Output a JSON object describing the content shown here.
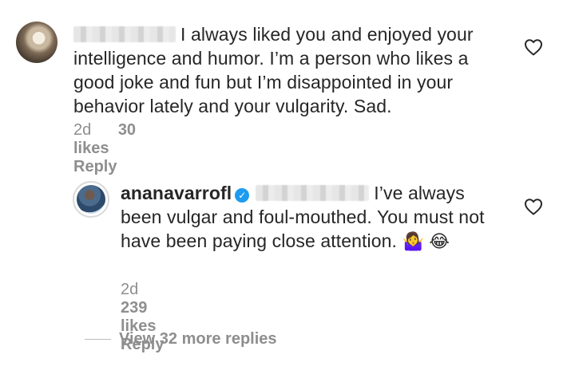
{
  "comment1": {
    "username_redacted": true,
    "text": "I always liked you and enjoyed your intelligence and humor. I’m a person who likes a good joke and fun but I’m disappointed in your behavior lately and your vulgarity. Sad.",
    "time": "2d",
    "likes": "30 likes",
    "reply_label": "Reply"
  },
  "comment2": {
    "username": "ananavarrofl",
    "verified": true,
    "mention_redacted": true,
    "text": "I’ve always been vulgar and foul-mouthed. You must not have been paying close attention.",
    "emojis": "🤷‍♀️ 😂",
    "time": "2d",
    "likes": "239 likes",
    "reply_label": "Reply"
  },
  "view_replies": "View 32 more replies",
  "icons": {
    "like": "heart-icon",
    "verified": "verified-badge-icon"
  },
  "colors": {
    "text": "#262626",
    "meta": "#8e8e8e",
    "verified": "#1d9bf0"
  }
}
